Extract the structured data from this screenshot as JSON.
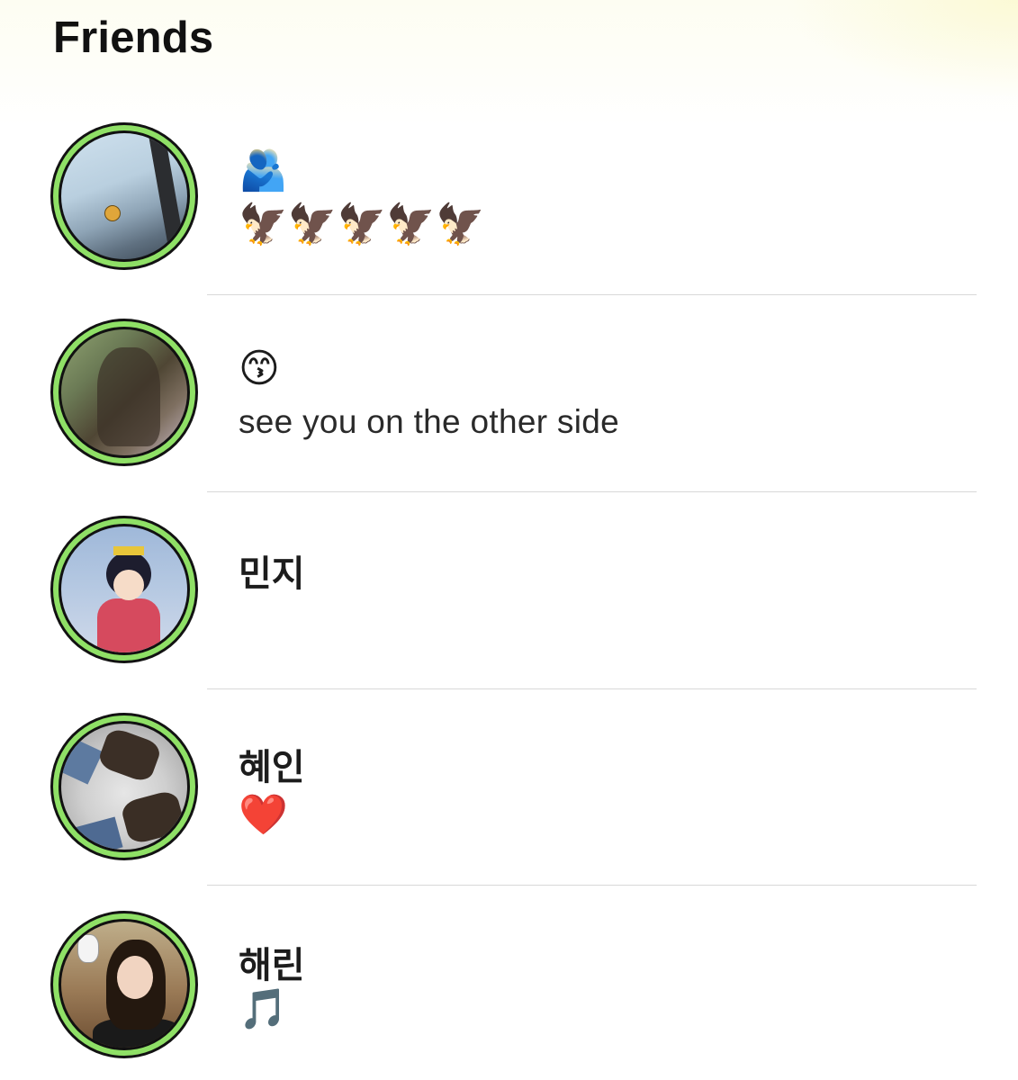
{
  "header": {
    "title": "Friends"
  },
  "friends": [
    {
      "avatar_icon": "window-sky-photo-avatar",
      "line1": "🫂",
      "line2": "🦅🦅🦅🦅🦅",
      "line2_kind": "emoji"
    },
    {
      "avatar_icon": "reflection-photo-avatar",
      "line1": "😙",
      "line1_kind": "emoji",
      "line2": "see you on the other side",
      "line2_kind": "text"
    },
    {
      "avatar_icon": "anime-girl-avatar",
      "line1": "민지",
      "line2": ""
    },
    {
      "avatar_icon": "shoes-photo-avatar",
      "line1": "혜인",
      "line2": "❤️",
      "line2_kind": "emoji"
    },
    {
      "avatar_icon": "girl-selfie-avatar",
      "line1": "해린",
      "line2": "🎵",
      "line2_kind": "emoji"
    }
  ],
  "colors": {
    "ring_green": "#8fe066",
    "ring_outline": "#121212",
    "divider": "#d8d8d8"
  }
}
